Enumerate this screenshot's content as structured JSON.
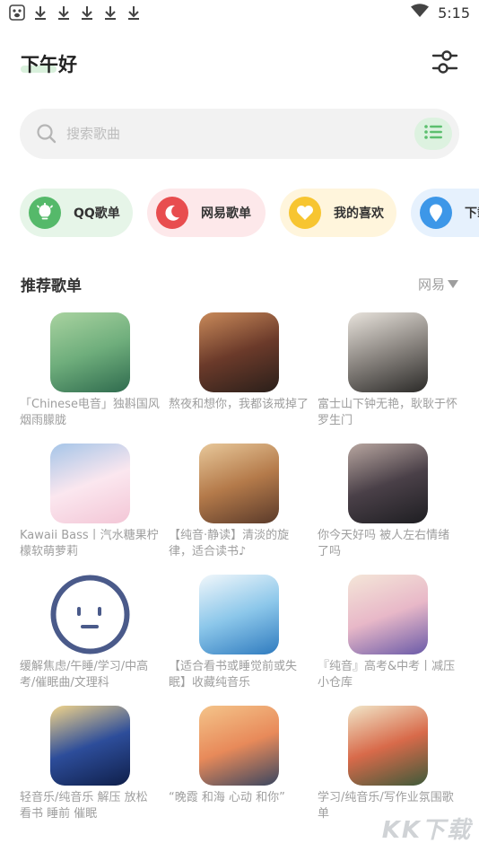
{
  "status": {
    "time": "5:15"
  },
  "header": {
    "greeting": "下午好"
  },
  "search": {
    "placeholder": "搜索歌曲"
  },
  "chips": [
    {
      "label": "QQ歌单",
      "bg": "#e6f5e8",
      "icon_bg": "#55b96a",
      "icon": "lightbulb-icon"
    },
    {
      "label": "网易歌单",
      "bg": "#fde8ea",
      "icon_bg": "#e84d4f",
      "icon": "moon-icon"
    },
    {
      "label": "我的喜欢",
      "bg": "#fff5dc",
      "icon_bg": "#f7c531",
      "icon": "heart-icon"
    },
    {
      "label": "下载",
      "bg": "#e6f1fd",
      "icon_bg": "#3d97e8",
      "icon": "location-pin-icon"
    }
  ],
  "section": {
    "title": "推荐歌单",
    "source": "网易"
  },
  "playlists": [
    {
      "title": "「Chinese电音」独斟国风烟雨朦胧",
      "palette": [
        "#2f6b4e",
        "#6fae7c",
        "#a9d3a0"
      ]
    },
    {
      "title": "熬夜和想你，我都该戒掉了",
      "palette": [
        "#2a1f1a",
        "#6b3a2a",
        "#c98a5a"
      ]
    },
    {
      "title": "富士山下钟无艳，耿耿于怀罗生门",
      "palette": [
        "#2b2a28",
        "#8a8580",
        "#e8e3dc"
      ]
    },
    {
      "title": "Kawaii Bass丨汽水糖果柠檬软萌萝莉",
      "palette": [
        "#f3c6d6",
        "#fbe7ef",
        "#a5c5e8"
      ]
    },
    {
      "title": "【纯音·静读】清淡的旋律，适合读书♪",
      "palette": [
        "#5a3a2a",
        "#b47a4a",
        "#e8c89a"
      ]
    },
    {
      "title": "你今天好吗 被人左右情绪了吗",
      "palette": [
        "#1e1e22",
        "#4a4048",
        "#b8a6a0"
      ]
    },
    {
      "title": "缓解焦虑/午睡/学习/中高考/催眠曲/文理科",
      "palette": [
        "#ffffff",
        "#4a5a8a",
        "#ffffff"
      ]
    },
    {
      "title": "【适合看书或睡觉前或失眠】收藏纯音乐",
      "palette": [
        "#2f7bbf",
        "#8cc7ea",
        "#f1f7fb"
      ]
    },
    {
      "title": "『纯音』高考&中考丨减压小仓库",
      "palette": [
        "#6a5aa8",
        "#e8b8c8",
        "#f4e6d8"
      ]
    },
    {
      "title": "轻音乐/纯音乐 解压 放松 看书 睡前 催眠",
      "palette": [
        "#0f1f4a",
        "#2d4d9a",
        "#f1d48a"
      ]
    },
    {
      "title": "“晚霞 和海 心动 和你”",
      "palette": [
        "#3a4660",
        "#e88a5a",
        "#f4c48a"
      ]
    },
    {
      "title": "学习/纯音乐/写作业氛围歌单",
      "palette": [
        "#3e5a3a",
        "#d86a4a",
        "#f1e6c8"
      ]
    }
  ],
  "watermark": "KK下载"
}
